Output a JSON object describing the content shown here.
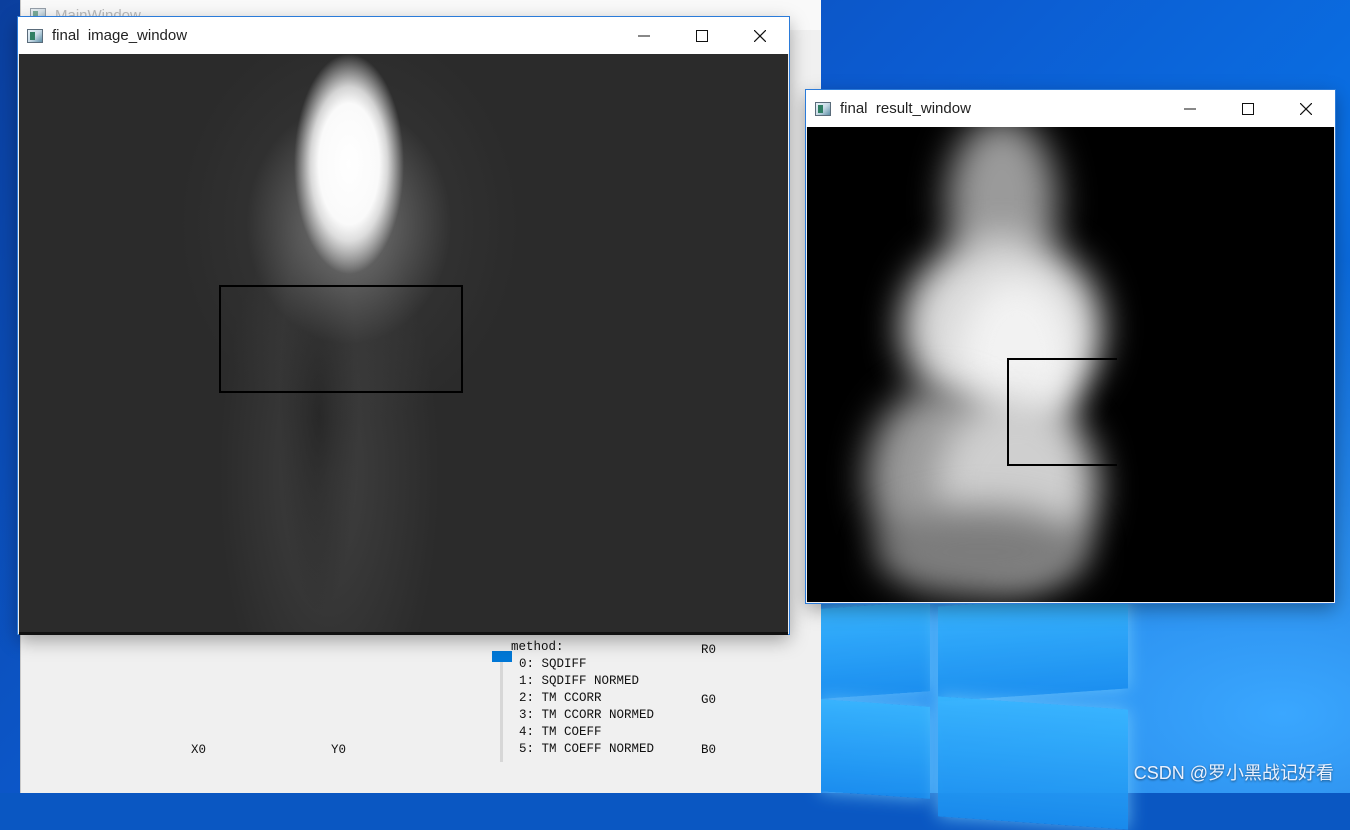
{
  "main_window": {
    "title": "MainWindow",
    "method_label": "method:",
    "methods": [
      "0: SQDIFF",
      "1: SQDIFF NORMED",
      "2: TM CCORR",
      "3: TM CCORR NORMED",
      "4: TM COEFF",
      "5: TM COEFF NORMED"
    ],
    "readouts": {
      "x": "X0",
      "y": "Y0",
      "r": "R0",
      "g": "G0",
      "b": "B0"
    },
    "slider_value": 0
  },
  "image_window": {
    "title": "final  image_window"
  },
  "result_window": {
    "title": "final  result_window"
  },
  "watermark": "CSDN @罗小黑战记好看",
  "colors": {
    "accent": "#0078d7",
    "desktop": "#0c5bd0"
  },
  "icons": {
    "minimize": "minimize-icon",
    "maximize": "maximize-icon",
    "close": "close-icon",
    "app": "app-icon"
  }
}
